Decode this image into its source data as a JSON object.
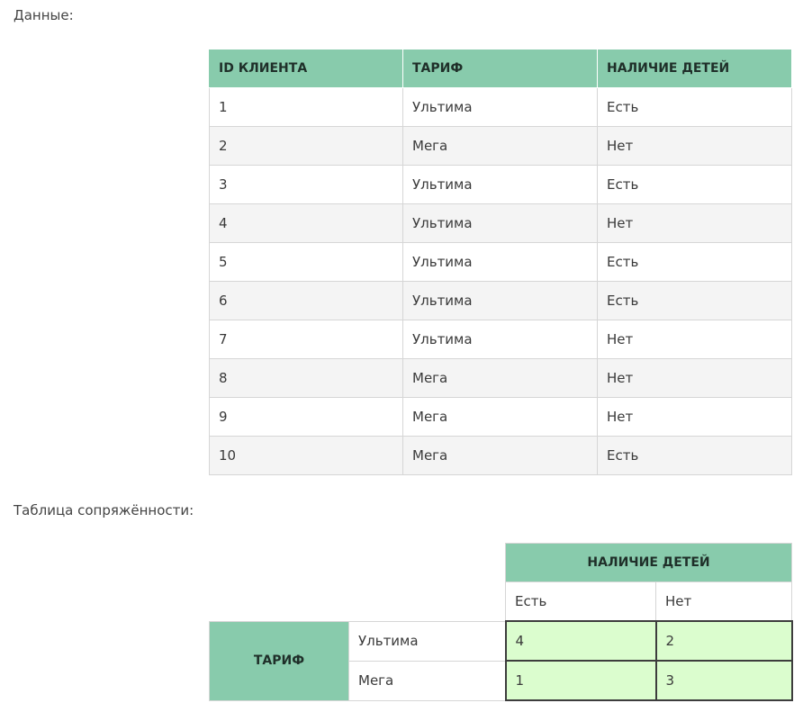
{
  "captions": {
    "data": "Данные:",
    "contingency": "Таблица сопряжённости:"
  },
  "data_table": {
    "headers": [
      "ID КЛИЕНТА",
      "ТАРИФ",
      "НАЛИЧИЕ ДЕТЕЙ"
    ],
    "rows": [
      [
        "1",
        "Ультима",
        "Есть"
      ],
      [
        "2",
        "Мега",
        "Нет"
      ],
      [
        "3",
        "Ультима",
        "Есть"
      ],
      [
        "4",
        "Ультима",
        "Нет"
      ],
      [
        "5",
        "Ультима",
        "Есть"
      ],
      [
        "6",
        "Ультима",
        "Есть"
      ],
      [
        "7",
        "Ультима",
        "Нет"
      ],
      [
        "8",
        "Мега",
        "Нет"
      ],
      [
        "9",
        "Мега",
        "Нет"
      ],
      [
        "10",
        "Мега",
        "Есть"
      ]
    ]
  },
  "contingency_table": {
    "col_group_header": "НАЛИЧИЕ ДЕТЕЙ",
    "col_headers": [
      "Есть",
      "Нет"
    ],
    "row_group_header": "ТАРИФ",
    "rows": [
      {
        "label": "Ультима",
        "values": [
          "4",
          "2"
        ]
      },
      {
        "label": "Мега",
        "values": [
          "1",
          "3"
        ]
      }
    ]
  },
  "colors": {
    "header_green": "#88cbac",
    "cell_highlight": "#dbfdce"
  }
}
